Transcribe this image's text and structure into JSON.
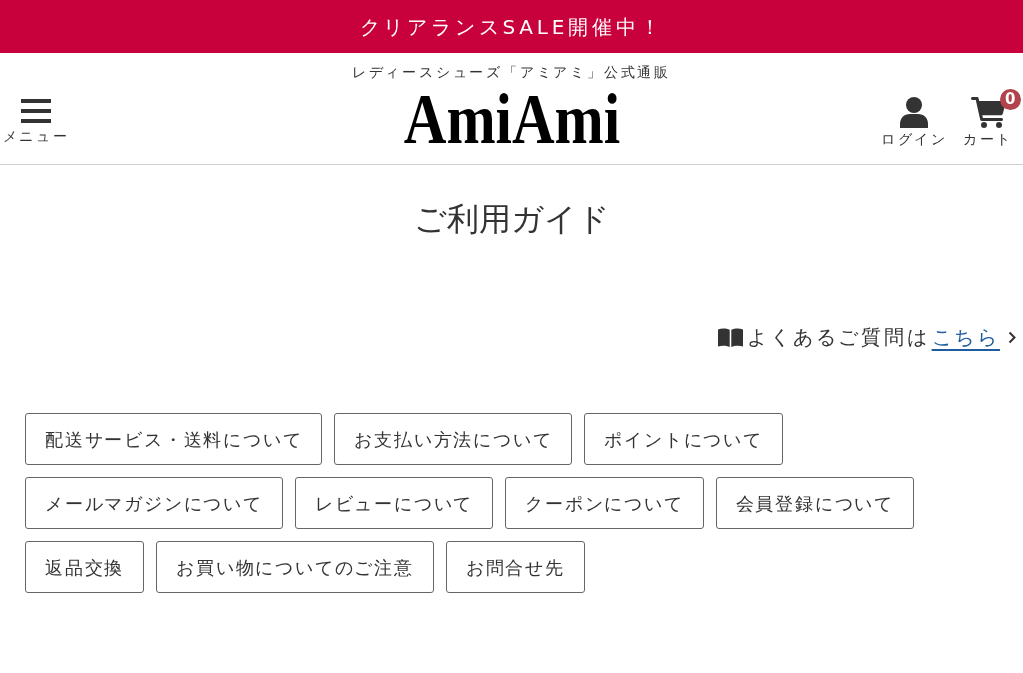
{
  "banner": {
    "text": "クリアランスSALE開催中！"
  },
  "header": {
    "tagline": "レディースシューズ「アミアミ」公式通販",
    "menu": {
      "label": "メニュー"
    },
    "logo": "AmiAmi",
    "login": {
      "label": "ログイン"
    },
    "cart": {
      "label": "カート",
      "count": "0"
    }
  },
  "page_title": "ご利用ガイド",
  "faq": {
    "text": "よくあるご質問は",
    "link": "こちら"
  },
  "guide_links": [
    "配送サービス・送料について",
    "お支払い方法について",
    "ポイントについて",
    "メールマガジンについて",
    "レビューについて",
    "クーポンについて",
    "会員登録について",
    "返品交換",
    "お買い物についてのご注意",
    "お問合せ先"
  ]
}
